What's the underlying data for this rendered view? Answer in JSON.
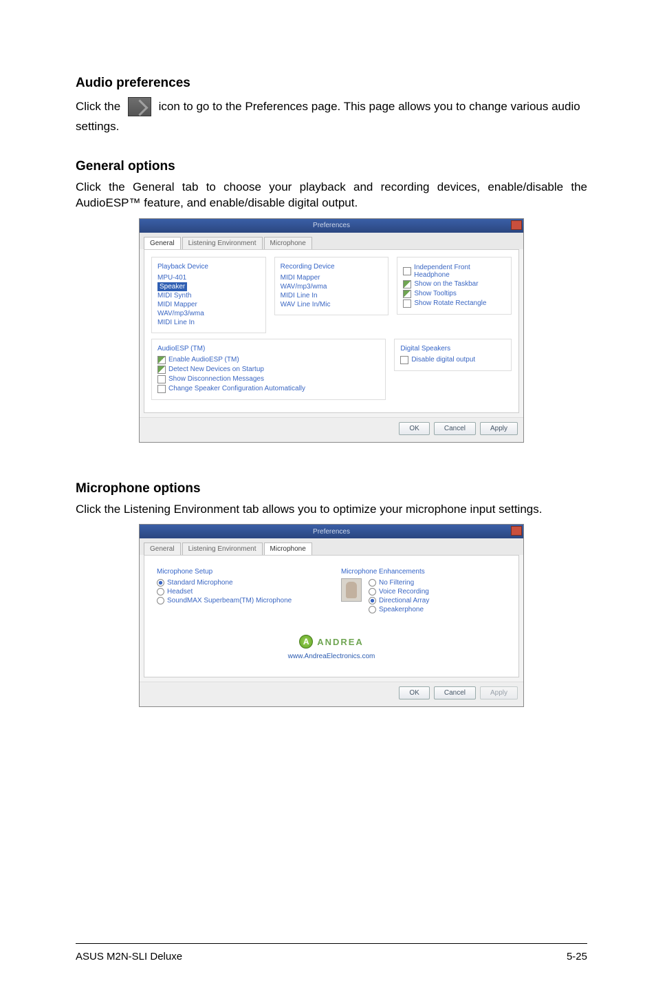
{
  "sections": {
    "audio_prefs": {
      "heading": "Audio preferences",
      "line_pre": "Click the ",
      "line_post": " icon to go to the Preferences page. This page allows you to change various audio settings.",
      "tool_icon_name": "wrench-icon"
    },
    "general": {
      "heading": "General options",
      "body": "Click the General tab to choose your playback and recording devices, enable/disable the AudioESP™ feature, and enable/disable digital output."
    },
    "microphone": {
      "heading": "Microphone options",
      "body": "Click the Listening Environment tab allows you to optimize your microphone input settings."
    }
  },
  "prefs_window": {
    "title": "Preferences",
    "tabs": [
      "General",
      "Listening Environment",
      "Microphone"
    ],
    "active_tab": 0,
    "playback": {
      "title": "Playback Device",
      "items": [
        "MPU-401",
        "Speaker",
        "MIDI Synth",
        "MIDI Mapper",
        "WAV/mp3/wma",
        "MIDI Line In"
      ],
      "selected_index": 1
    },
    "recording": {
      "title": "Recording Device",
      "items": [
        "MIDI Mapper",
        "WAV/mp3/wma",
        "MIDI Line In",
        "WAV Line In/Mic"
      ]
    },
    "others": {
      "title": "",
      "items": [
        {
          "label": "Independent Front Headphone",
          "checked": false
        },
        {
          "label": "Show on the Taskbar",
          "checked": true
        },
        {
          "label": "Show Tooltips",
          "checked": true
        },
        {
          "label": "Show Rotate Rectangle",
          "checked": false
        }
      ]
    },
    "audio_esp": {
      "title": "AudioESP (TM)",
      "items": [
        {
          "label": "Enable AudioESP (TM)",
          "checked": true
        },
        {
          "label": "Detect New Devices on Startup",
          "checked": true
        },
        {
          "label": "Show Disconnection Messages",
          "checked": false
        },
        {
          "label": "Change Speaker Configuration Automatically",
          "checked": false
        }
      ]
    },
    "digital_out": {
      "title": "Digital Speakers",
      "items": [
        {
          "label": "Disable digital output",
          "checked": false
        }
      ]
    },
    "buttons": [
      "OK",
      "Cancel",
      "Apply"
    ]
  },
  "mic_window": {
    "title": "Preferences",
    "tabs": [
      "General",
      "Listening Environment",
      "Microphone"
    ],
    "active_tab": 2,
    "setup": {
      "title": "Microphone Setup",
      "items": [
        {
          "label": "Standard Microphone",
          "checked": true
        },
        {
          "label": "Headset",
          "checked": false
        },
        {
          "label": "SoundMAX Superbeam(TM) Microphone",
          "checked": false
        }
      ]
    },
    "enhance": {
      "title": "Microphone Enhancements",
      "items": [
        {
          "label": "No Filtering",
          "checked": false
        },
        {
          "label": "Voice Recording",
          "checked": false
        },
        {
          "label": "Directional Array",
          "checked": true
        },
        {
          "label": "Speakerphone",
          "checked": false
        }
      ]
    },
    "logo_text": "ANDREA",
    "logo_url": "www.AndreaElectronics.com",
    "buttons": [
      "OK",
      "Cancel",
      "Apply"
    ]
  },
  "footer": {
    "left": "ASUS M2N-SLI Deluxe",
    "right": "5-25"
  }
}
